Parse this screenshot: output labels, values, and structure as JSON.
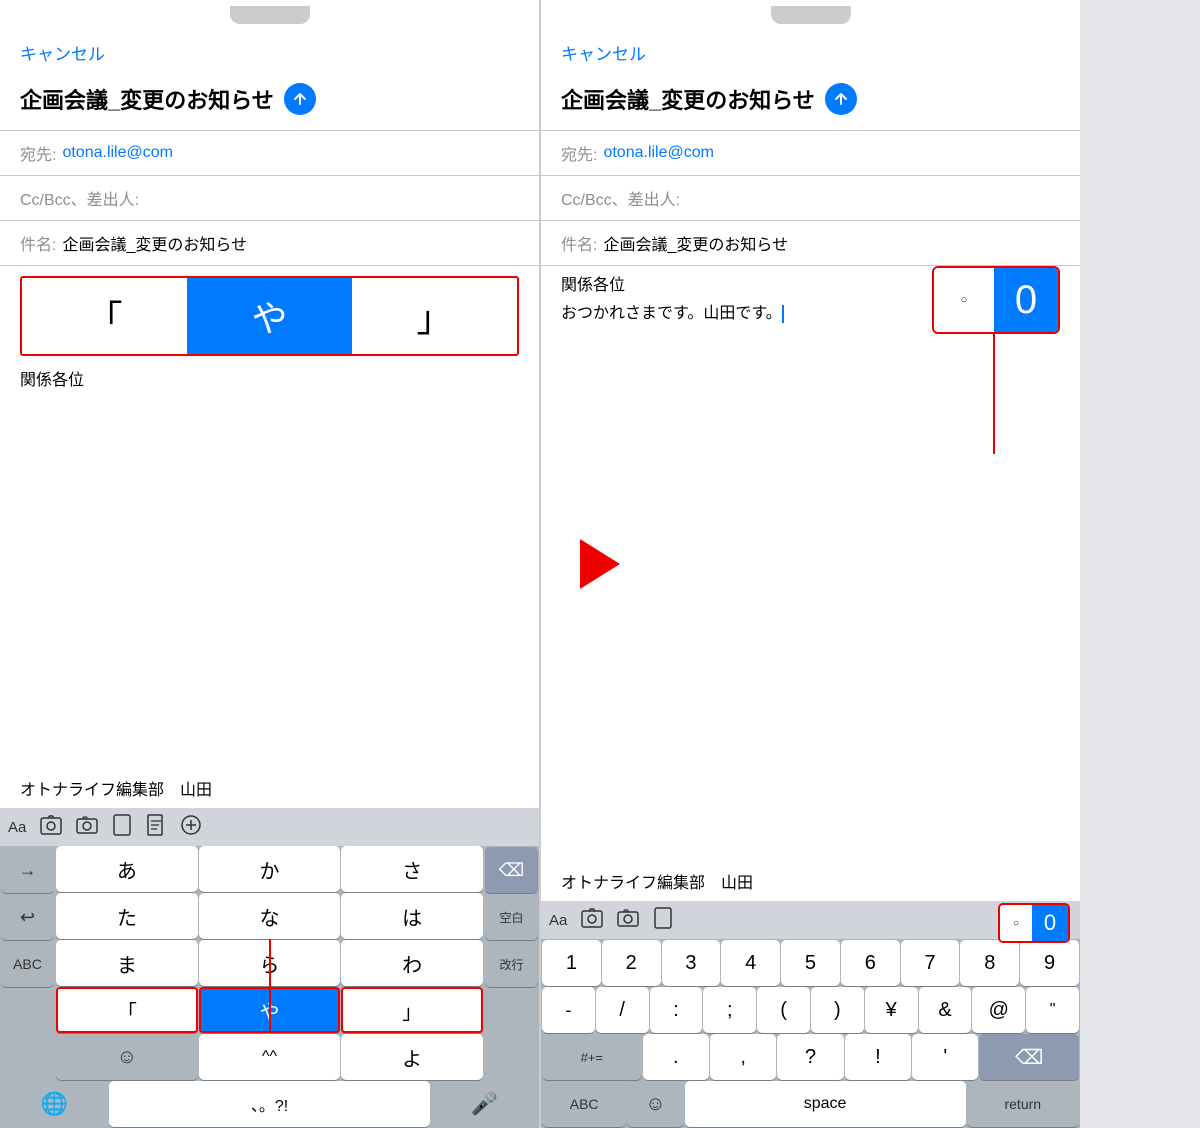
{
  "left_phone": {
    "cancel": "キャンセル",
    "title": "企画会議_変更のお知らせ",
    "to_label": "宛先:",
    "to_value": "otona.lile@com",
    "cc_label": "Cc/Bcc、差出人:",
    "subject_label": "件名:",
    "subject_value": "企画会議_変更のお知らせ",
    "body_line1": "関係各位",
    "signature": "オトナライフ編集部　山田",
    "popup_left": "「",
    "popup_center": "や",
    "popup_right": "」",
    "keyboard": {
      "toolbar_aa": "Aa",
      "row1": [
        "あ",
        "か",
        "さ"
      ],
      "row2": [
        "た",
        "な",
        "は"
      ],
      "row3": [
        "ま",
        "ら",
        "わ"
      ],
      "side_left": [
        "→",
        "↩",
        "ABC"
      ],
      "side_right": [
        "⌫",
        "空白",
        "改行"
      ],
      "bottom": [
        "☺",
        "^^",
        "よ",
        "、。?!"
      ],
      "bottom_key_ya_left": "「",
      "bottom_key_ya": "や",
      "bottom_key_ya_right": "」"
    }
  },
  "right_phone": {
    "cancel": "キャンセル",
    "title": "企画会議_変更のお知らせ",
    "to_label": "宛先:",
    "to_value": "otona.lile@com",
    "cc_label": "Cc/Bcc、差出人:",
    "subject_label": "件名:",
    "subject_value": "企画会議_変更のお知らせ",
    "body_line1": "関係各位",
    "body_line2": "おつかれさまです。山田です。",
    "signature": "オトナライフ編集部　山田",
    "popup_dot": "·",
    "popup_zero": "0",
    "keyboard": {
      "toolbar_aa": "Aa",
      "row1": [
        "1",
        "2",
        "3",
        "4",
        "5",
        "6",
        "7",
        "8",
        "9"
      ],
      "row2": [
        "-",
        "/",
        ":",
        ";",
        "(",
        ")",
        "¥",
        "&",
        "@",
        "\""
      ],
      "row3_left": "#+=",
      "row3_mid": [
        ".",
        ",",
        "?",
        "!",
        "'"
      ],
      "row3_right": "⌫",
      "bottom_abc": "ABC",
      "bottom_emoji": "☺",
      "bottom_space": "space",
      "bottom_return": "return"
    }
  },
  "arrow": "→"
}
